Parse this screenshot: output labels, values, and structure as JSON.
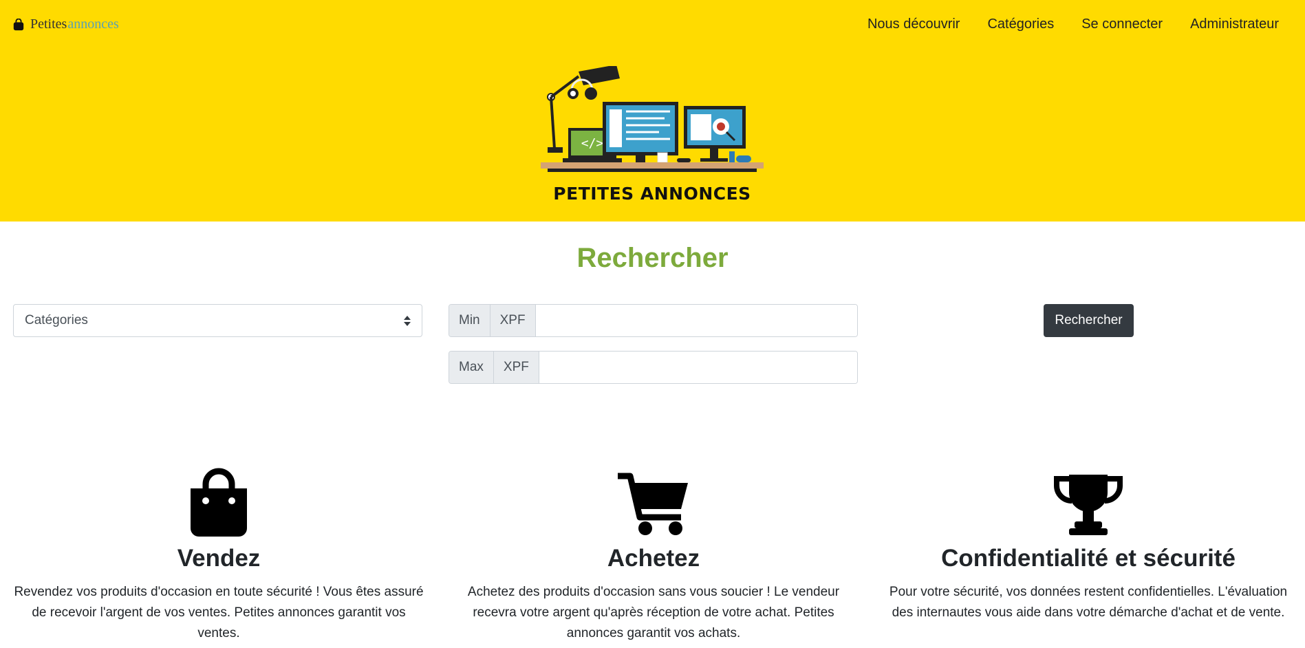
{
  "brand": {
    "part1": "Petites",
    "part2": "annonces",
    "icon": "shopping-bag-icon"
  },
  "nav": {
    "items": [
      {
        "label": "Nous découvrir"
      },
      {
        "label": "Catégories"
      },
      {
        "label": "Se connecter"
      },
      {
        "label": "Administrateur"
      }
    ]
  },
  "hero": {
    "logo_text": "PETITES ANNONCES",
    "background": "#ffdb00"
  },
  "search": {
    "title": "Rechercher",
    "title_color": "#7daa3c",
    "category_select": {
      "selected": "Catégories"
    },
    "min": {
      "label": "Min",
      "currency": "XPF",
      "value": ""
    },
    "max": {
      "label": "Max",
      "currency": "XPF",
      "value": ""
    },
    "button_label": "Rechercher"
  },
  "features": [
    {
      "icon": "shopping-bag-icon",
      "title": "Vendez",
      "text": "Revendez vos produits d'occasion en toute sécurité ! Vous êtes assuré de recevoir l'argent de vos ventes. Petites annonces garantit vos ventes."
    },
    {
      "icon": "shopping-cart-icon",
      "title": "Achetez",
      "text": "Achetez des produits d'occasion sans vous soucier ! Le vendeur recevra votre argent qu'après réception de votre achat. Petites annonces garantit vos achats."
    },
    {
      "icon": "trophy-icon",
      "title": "Confidentialité et sécurité",
      "text": "Pour votre sécurité, vos données restent confidentielles. L'évaluation des internautes vous aide dans votre démarche d'achat et de vente."
    }
  ]
}
